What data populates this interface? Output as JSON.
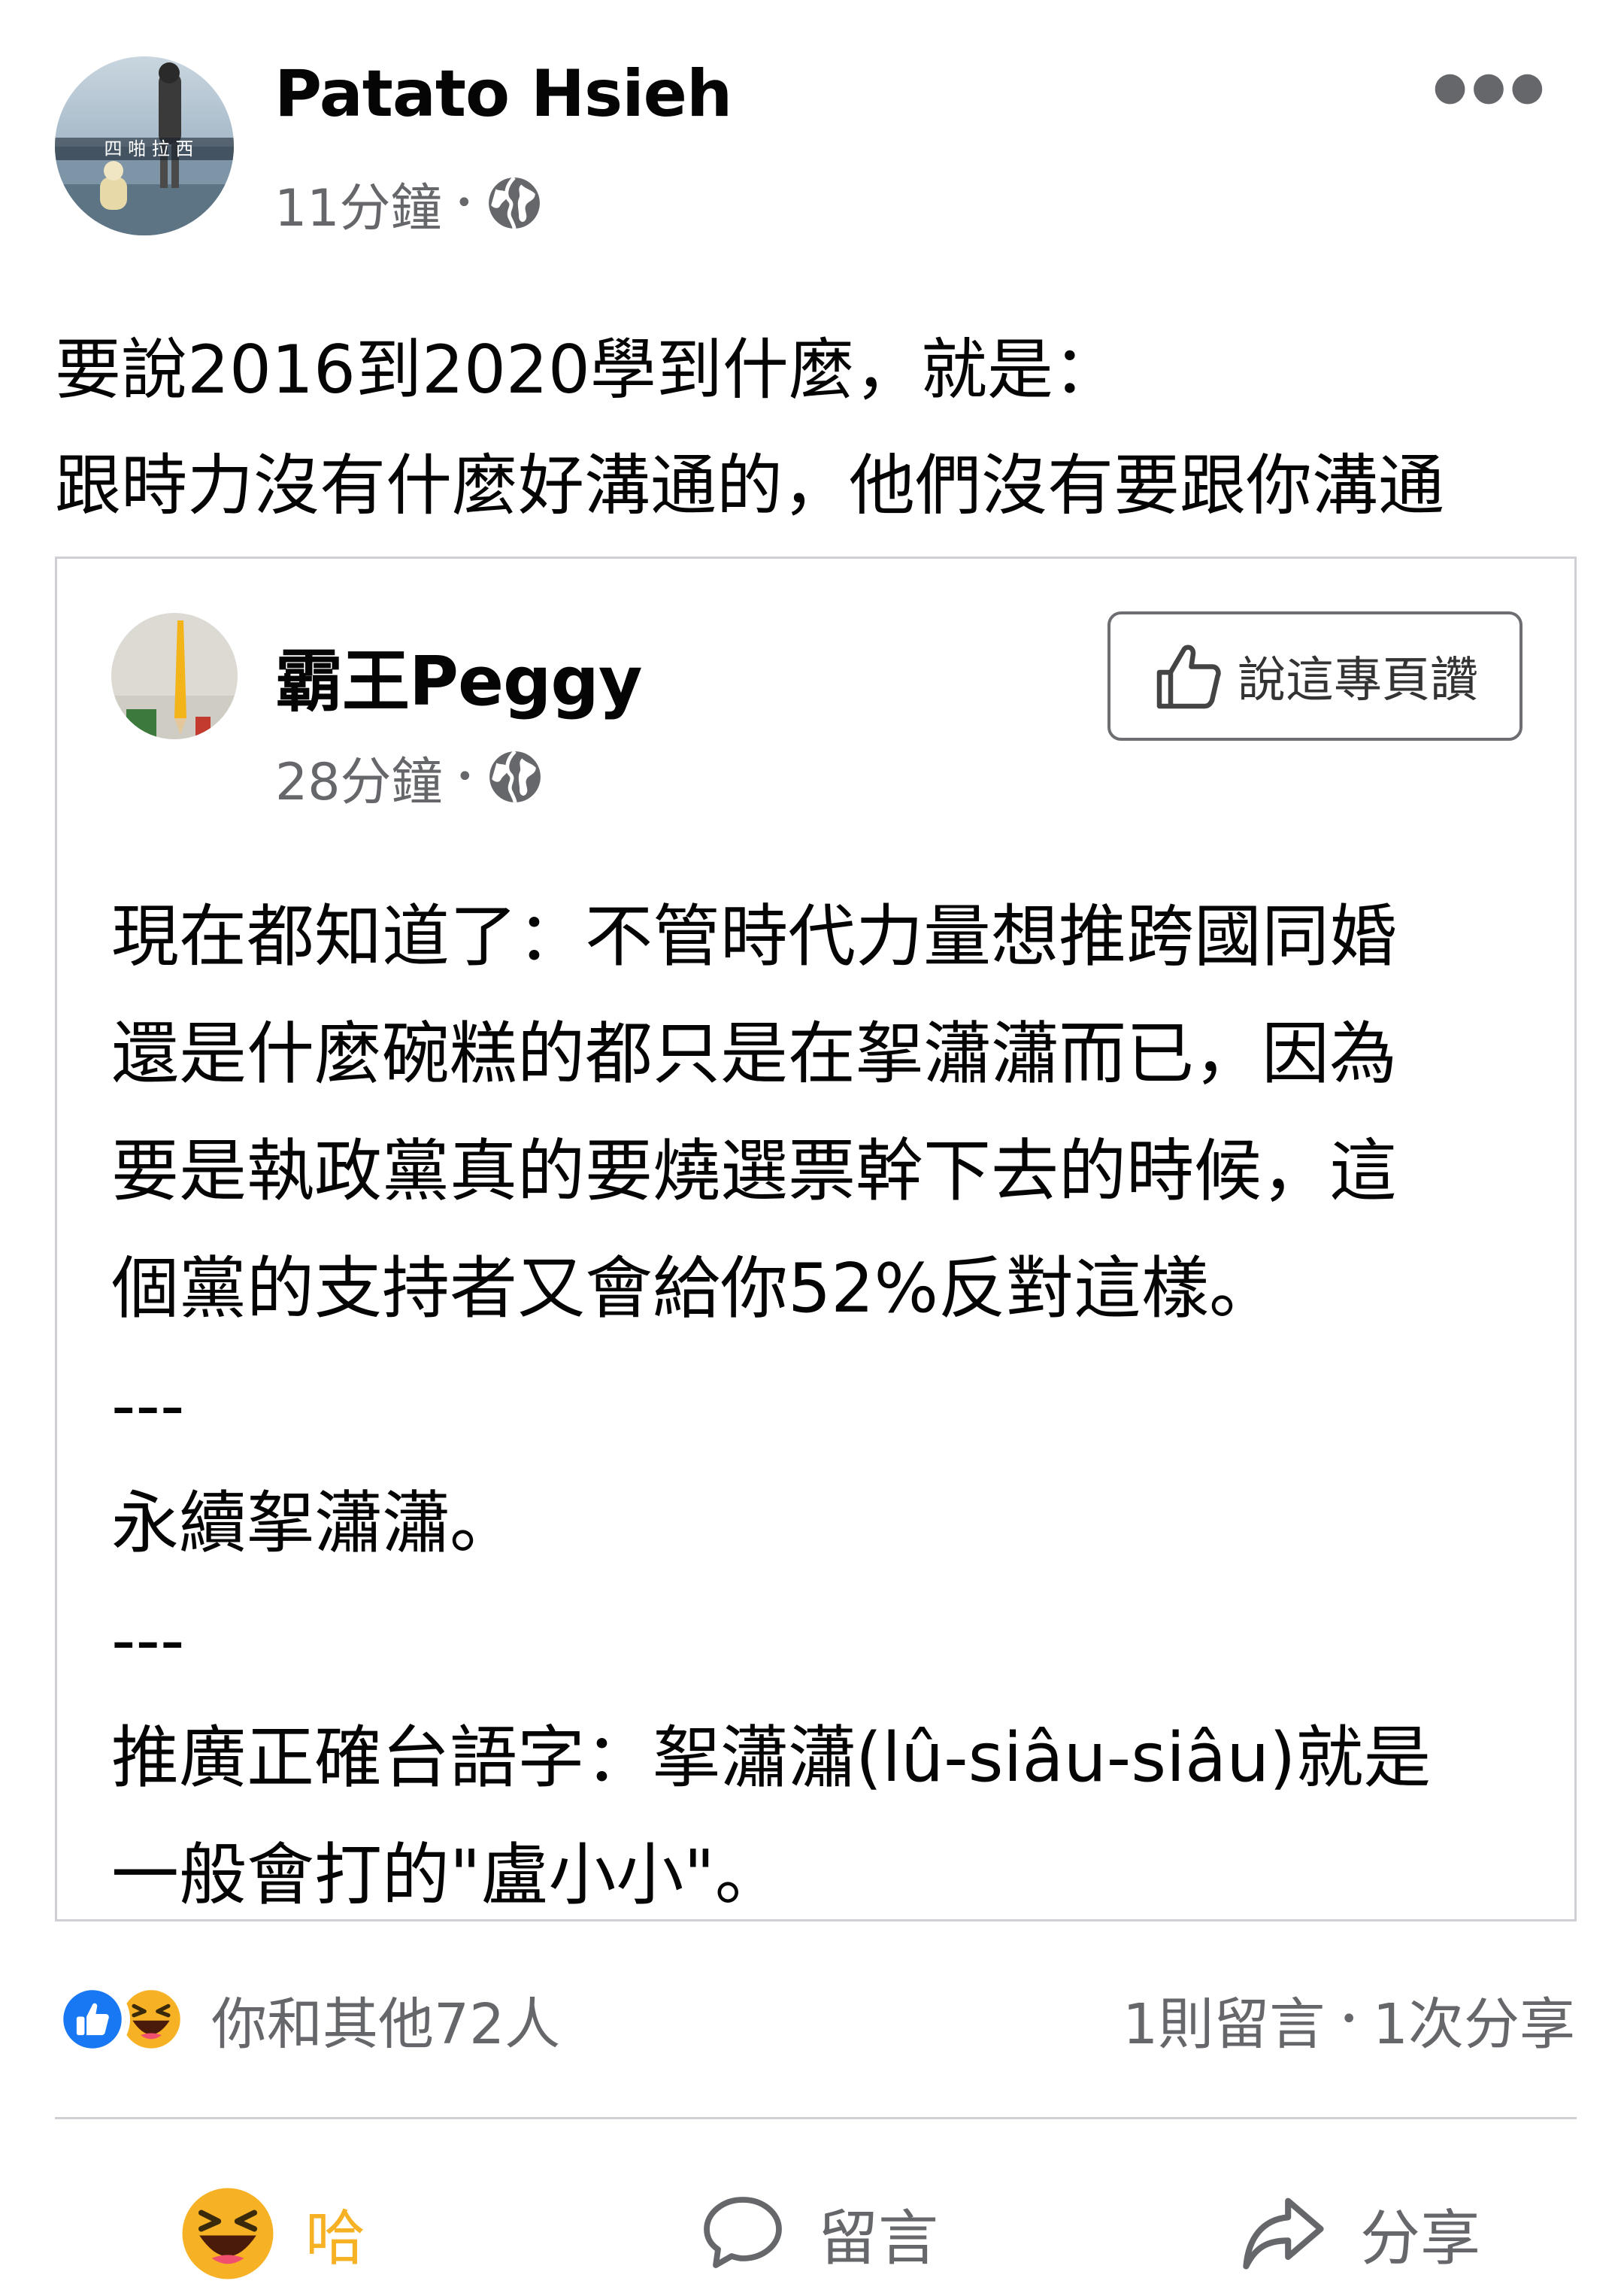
{
  "post": {
    "author": "Patato Hsieh",
    "avatar_caption": "四 啪 拉 西",
    "time": "11分鐘",
    "privacy_icon": "globe-icon",
    "more_icon": "more-options-icon",
    "text_lines": [
      "要說2016到2020學到什麼，就是：",
      "跟時力沒有什麼好溝通的，他們沒有要跟你溝通"
    ]
  },
  "shared": {
    "author": "霸王Peggy",
    "time": "28分鐘",
    "like_page_label": "說這專頁讚",
    "like_page_icon": "thumbs-up-outline-icon",
    "text_lines": [
      "現在都知道了：不管時代力量想推跨國同婚",
      "還是什麼碗糕的都只是在挐瀟瀟而已，因為",
      "要是執政黨真的要燒選票幹下去的時候，這",
      "個黨的支持者又會給你52%反對這樣。",
      "---",
      "永續挐瀟瀟。",
      "---",
      "推廣正確台語字：挐瀟瀟(lû-siâu-siâu)就是",
      "一般會打的\"盧小小\"。"
    ]
  },
  "footer": {
    "reaction_icons": [
      "like-reaction-icon",
      "haha-reaction-icon"
    ],
    "reaction_summary": "你和其他72人",
    "comments": "1則留言",
    "shares": "1次分享",
    "separator": "•",
    "actions": {
      "haha": "哈",
      "comment": "留言",
      "share": "分享"
    }
  },
  "colors": {
    "secondary_text": "#65676b",
    "like_blue": "#1877f2",
    "haha_yellow": "#f7b125",
    "border": "#ced0d4"
  }
}
